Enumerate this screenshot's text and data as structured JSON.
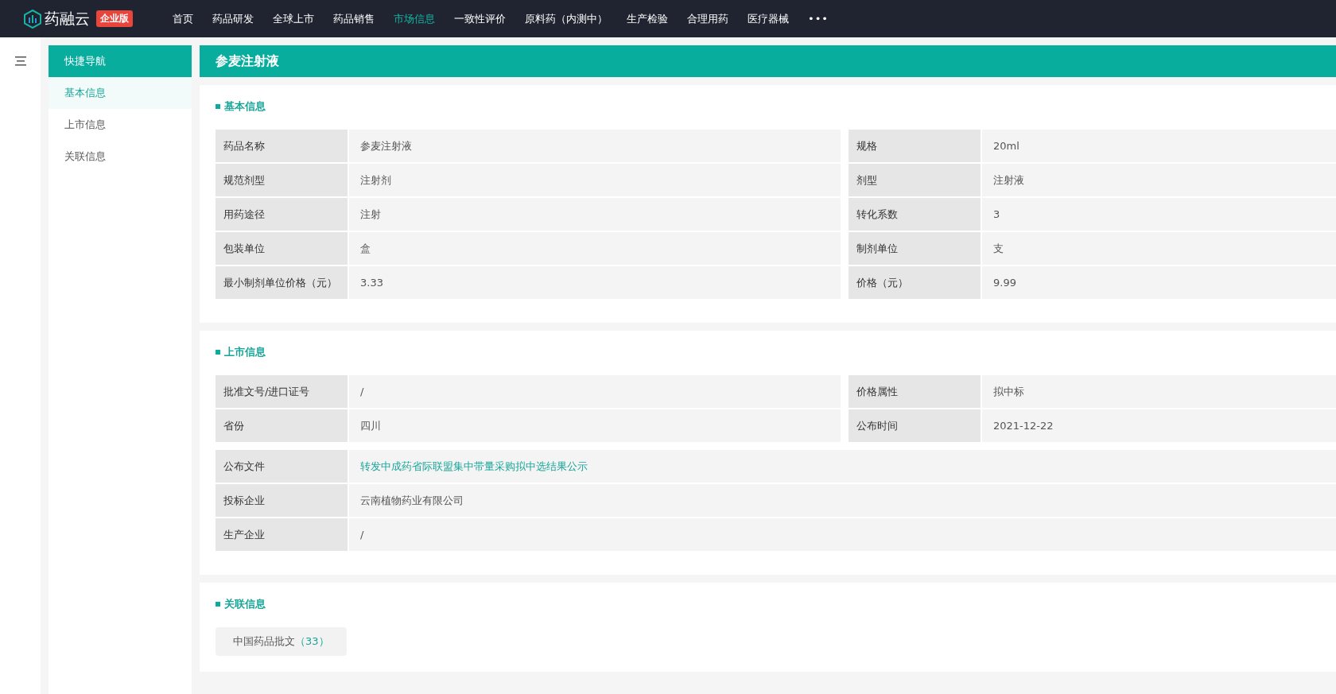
{
  "header": {
    "logo_text": "药融云",
    "edition_badge": "企业版",
    "nav": [
      {
        "label": "首页",
        "selected": false
      },
      {
        "label": "药品研发",
        "selected": false
      },
      {
        "label": "全球上市",
        "selected": false
      },
      {
        "label": "药品销售",
        "selected": false
      },
      {
        "label": "市场信息",
        "selected": true
      },
      {
        "label": "一致性评价",
        "selected": false
      },
      {
        "label": "原料药（内测中）",
        "selected": false
      },
      {
        "label": "生产检验",
        "selected": false
      },
      {
        "label": "合理用药",
        "selected": false
      },
      {
        "label": "医疗器械",
        "selected": false
      }
    ],
    "more": "•••"
  },
  "quick_nav": {
    "title": "快捷导航",
    "items": [
      {
        "label": "基本信息",
        "selected": true
      },
      {
        "label": "上市信息",
        "selected": false
      },
      {
        "label": "关联信息",
        "selected": false
      }
    ]
  },
  "title": "参麦注射液",
  "sections": [
    {
      "heading": "基本信息",
      "kind": "table",
      "tables": [
        {
          "kind": "pairs",
          "rows": [
            [
              {
                "label": "药品名称",
                "value": "参麦注射液"
              },
              {
                "label": "规格",
                "value": "20ml"
              }
            ],
            [
              {
                "label": "规范剂型",
                "value": "注射剂"
              },
              {
                "label": "剂型",
                "value": "注射液"
              }
            ],
            [
              {
                "label": "用药途径",
                "value": "注射"
              },
              {
                "label": "转化系数",
                "value": "3"
              }
            ],
            [
              {
                "label": "包装单位",
                "value": "盒"
              },
              {
                "label": "制剂单位",
                "value": "支"
              }
            ],
            [
              {
                "label": "最小制剂单位价格（元）",
                "value": "3.33"
              },
              {
                "label": "价格（元）",
                "value": "9.99"
              }
            ]
          ]
        }
      ]
    },
    {
      "heading": "上市信息",
      "kind": "table",
      "tables": [
        {
          "kind": "pairs",
          "rows": [
            [
              {
                "label": "批准文号/进口证号",
                "value": "/"
              },
              {
                "label": "价格属性",
                "value": "拟中标"
              }
            ],
            [
              {
                "label": "省份",
                "value": "四川"
              },
              {
                "label": "公布时间",
                "value": "2021-12-22"
              }
            ]
          ]
        },
        {
          "kind": "full",
          "rows": [
            [
              {
                "label": "公布文件",
                "value": "转发中成药省际联盟集中带量采购拟中选结果公示",
                "kind": "link"
              }
            ],
            [
              {
                "label": "投标企业",
                "value": "云南植物药业有限公司"
              }
            ],
            [
              {
                "label": "生产企业",
                "value": "/"
              }
            ]
          ]
        }
      ]
    },
    {
      "heading": "关联信息",
      "kind": "tags",
      "tags": [
        {
          "label": "中国药品批文",
          "count": "（33）"
        }
      ]
    }
  ]
}
